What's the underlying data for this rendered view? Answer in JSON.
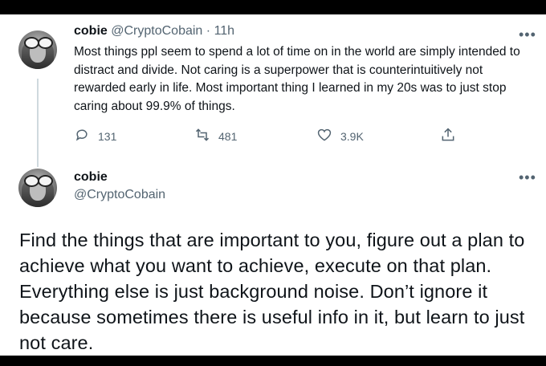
{
  "tweet1": {
    "name": "cobie",
    "handle": "@CryptoCobain",
    "separator": "·",
    "time": "11h",
    "text": "Most things ppl seem to spend a lot of time on in the world are simply intended to distract and divide. Not caring is a superpower that is counterintuitively not rewarded early in life. Most important thing I learned in my 20s was to just stop caring about 99.9% of things.",
    "actions": {
      "reply_icon": "reply-icon",
      "replies": "131",
      "retweet_icon": "retweet-icon",
      "retweets": "481",
      "like_icon": "like-icon",
      "likes": "3.9K",
      "share_icon": "share-icon"
    },
    "more_icon": "more-icon"
  },
  "tweet2": {
    "name": "cobie",
    "handle": "@CryptoCobain",
    "text": "Find the things that are important to you, figure out a plan to achieve what you want to achieve, execute on that plan. Everything else is just background noise. Don’t ignore it because sometimes there is useful info in it, but learn to just not care.",
    "more_icon": "more-icon"
  },
  "colors": {
    "text": "#0f1419",
    "muted": "#536471",
    "thread_line": "#cfd9de",
    "background": "#ffffff",
    "letterbox": "#000000"
  }
}
